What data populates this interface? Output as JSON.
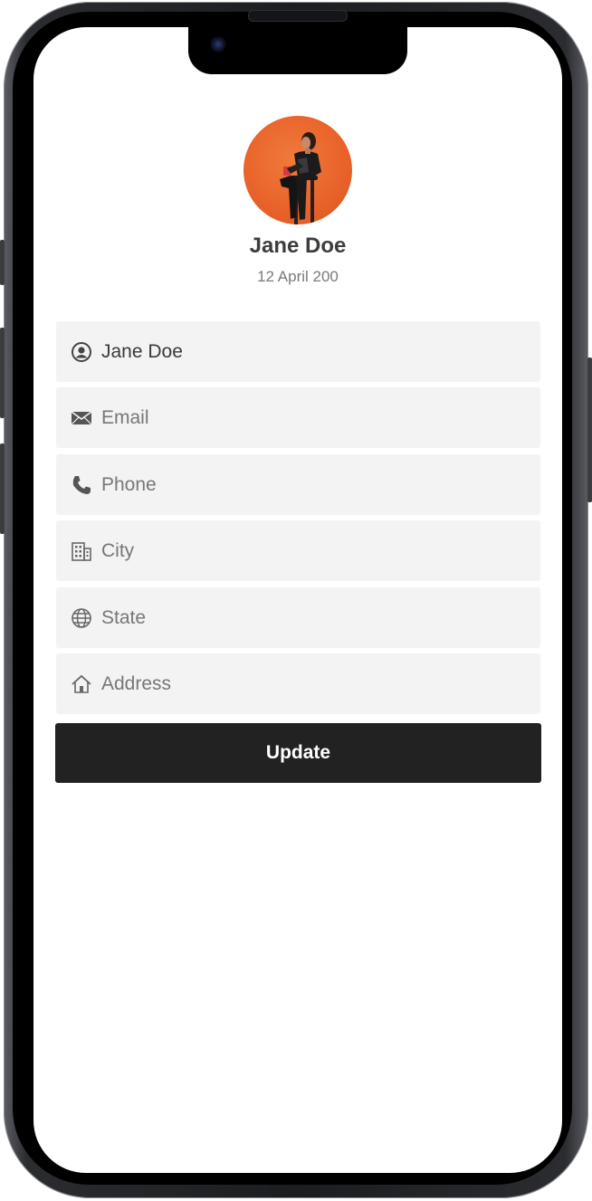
{
  "profile": {
    "name": "Jane Doe",
    "dob": "12 April 200"
  },
  "form": {
    "fields": [
      {
        "name": "name",
        "icon": "user-circle-icon",
        "value": "Jane Doe",
        "placeholder": ""
      },
      {
        "name": "email",
        "icon": "mail-icon",
        "value": "",
        "placeholder": "Email"
      },
      {
        "name": "phone",
        "icon": "phone-icon",
        "value": "",
        "placeholder": "Phone"
      },
      {
        "name": "city",
        "icon": "building-icon",
        "value": "",
        "placeholder": "City"
      },
      {
        "name": "state",
        "icon": "globe-icon",
        "value": "",
        "placeholder": "State"
      },
      {
        "name": "address",
        "icon": "home-icon",
        "value": "",
        "placeholder": "Address"
      }
    ],
    "name_text": "Jane Doe",
    "email_text": "Email",
    "phone_text": "Phone",
    "city_text": "City",
    "state_text": "State",
    "address_text": "Address",
    "submit_label": "Update"
  },
  "colors": {
    "accent_avatar_bg": "#e8622a",
    "field_bg": "#f3f3f3",
    "button_bg": "#222222",
    "button_text": "#ffffff",
    "placeholder_text": "#777777"
  }
}
